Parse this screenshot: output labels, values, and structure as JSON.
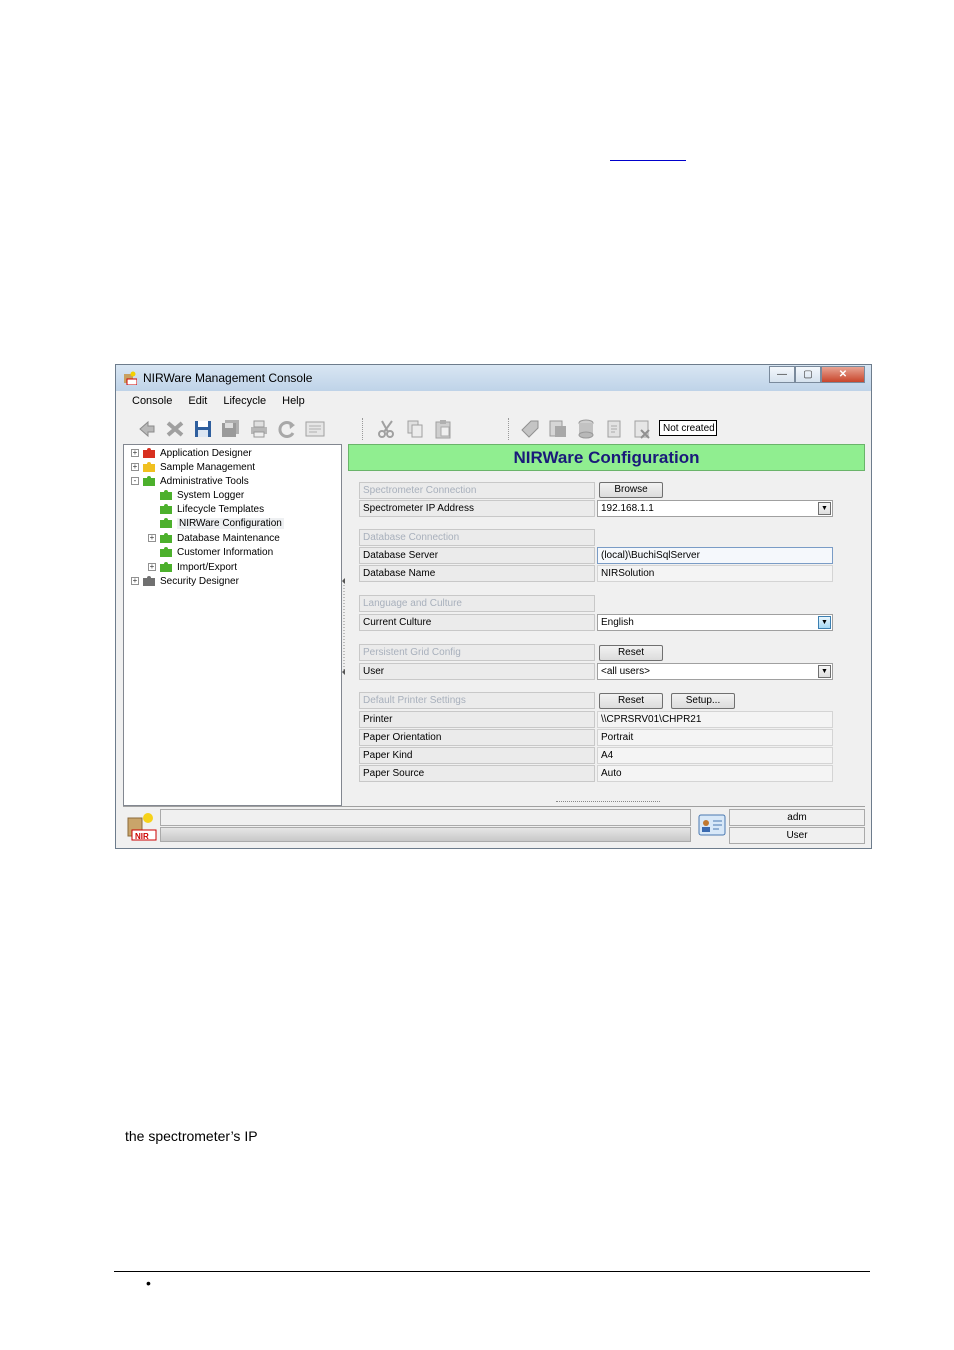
{
  "document": {
    "body_text": "the spectrometer’s IP",
    "footer_bullet": "•"
  },
  "window": {
    "title": "NIRWare Management Console",
    "controls": {
      "minimize": "—",
      "maximize": "▢",
      "close": "✕"
    },
    "menu": [
      "Console",
      "Edit",
      "Lifecycle",
      "Help"
    ],
    "toolbar": {
      "icons": [
        "back-icon",
        "delete-icon",
        "save-icon",
        "save-all-icon",
        "print-icon",
        "refresh-icon",
        "preview-icon",
        "cut-icon",
        "copy-icon",
        "paste-icon",
        "tag-icon",
        "export-icon",
        "database-icon",
        "report-icon",
        "clear-icon"
      ],
      "status_box": "Not created"
    },
    "tree": {
      "items": [
        {
          "label": "Application Designer",
          "level": 0,
          "expander": "+"
        },
        {
          "label": "Sample Management",
          "level": 0,
          "expander": "+"
        },
        {
          "label": "Administrative Tools",
          "level": 0,
          "expander": "-"
        },
        {
          "label": "System Logger",
          "level": 1,
          "expander": ""
        },
        {
          "label": "Lifecycle Templates",
          "level": 1,
          "expander": ""
        },
        {
          "label": "NIRWare Configuration",
          "level": 1,
          "expander": "",
          "selected": true
        },
        {
          "label": "Database Maintenance",
          "level": 1,
          "expander": "+"
        },
        {
          "label": "Customer Information",
          "level": 1,
          "expander": ""
        },
        {
          "label": "Import/Export",
          "level": 1,
          "expander": "+"
        },
        {
          "label": "Security Designer",
          "level": 0,
          "expander": "+"
        }
      ]
    },
    "config": {
      "header": "NIRWare Configuration",
      "spectrometer": {
        "group": "Spectrometer Connection",
        "browse": "Browse",
        "ip_label": "Spectrometer IP Address",
        "ip_value": "192.168.1.1"
      },
      "database": {
        "group": "Database Connection",
        "server_label": "Database Server",
        "server_value": "(local)\\BuchiSqlServer",
        "name_label": "Database Name",
        "name_value": "NIRSolution"
      },
      "culture": {
        "group": "Language and Culture",
        "label": "Current Culture",
        "value": "English"
      },
      "grid": {
        "group": "Persistent Grid Config",
        "reset": "Reset",
        "user_label": "User",
        "user_value": "<all users>"
      },
      "printer": {
        "group": "Default Printer Settings",
        "reset": "Reset",
        "setup": "Setup...",
        "printer_label": "Printer",
        "printer_value": "\\\\CPRSRV01\\CHPR21",
        "orientation_label": "Paper Orientation",
        "orientation_value": "Portrait",
        "kind_label": "Paper Kind",
        "kind_value": "A4",
        "source_label": "Paper Source",
        "source_value": "Auto"
      }
    },
    "status": {
      "user_name": "adm",
      "user_role": "User"
    }
  }
}
